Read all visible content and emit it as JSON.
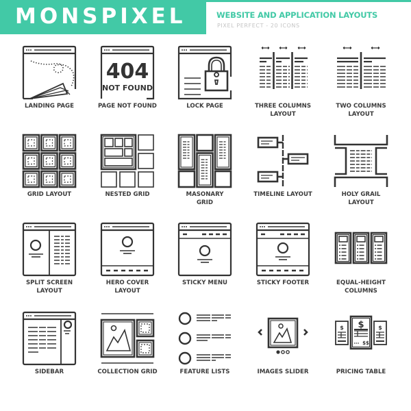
{
  "header": {
    "brand": "MONSPIXEL",
    "title": "WEBSITE AND APPLICATION LAYOUTS",
    "tagline": "PIXEL PERFECT - 20 ICONS",
    "accent_color": "#42c9a6",
    "icon_color": "#333333"
  },
  "icons": [
    {
      "icon": "landing-page-icon",
      "label_lines": [
        "LANDING PAGE"
      ]
    },
    {
      "icon": "page-not-found-icon",
      "label_lines": [
        "PAGE NOT FOUND"
      ],
      "glyph_big": "404",
      "glyph_small": "NOT FOUND"
    },
    {
      "icon": "lock-page-icon",
      "label_lines": [
        "LOCK PAGE"
      ]
    },
    {
      "icon": "three-columns-icon",
      "label_lines": [
        "THREE COLUMNS",
        "LAYOUT"
      ]
    },
    {
      "icon": "two-columns-icon",
      "label_lines": [
        "TWO COLUMNS",
        "LAYOUT"
      ]
    },
    {
      "icon": "grid-layout-icon",
      "label_lines": [
        "GRID LAYOUT"
      ]
    },
    {
      "icon": "nested-grid-icon",
      "label_lines": [
        "NESTED GRID"
      ]
    },
    {
      "icon": "masonary-grid-icon",
      "label_lines": [
        "MASONARY",
        "GRID"
      ]
    },
    {
      "icon": "timeline-layout-icon",
      "label_lines": [
        "TIMELINE LAYOUT"
      ]
    },
    {
      "icon": "holy-grail-icon",
      "label_lines": [
        "HOLY GRAIL",
        "LAYOUT"
      ]
    },
    {
      "icon": "split-screen-icon",
      "label_lines": [
        "SPLIT SCREEN",
        "LAYOUT"
      ]
    },
    {
      "icon": "hero-cover-icon",
      "label_lines": [
        "HERO COVER",
        "LAYOUT"
      ]
    },
    {
      "icon": "sticky-menu-icon",
      "label_lines": [
        "STICKY MENU"
      ]
    },
    {
      "icon": "sticky-footer-icon",
      "label_lines": [
        "STICKY FOOTER"
      ]
    },
    {
      "icon": "equal-height-columns-icon",
      "label_lines": [
        "EQUAL-HEIGHT",
        "COLUMNS"
      ]
    },
    {
      "icon": "sidebar-icon",
      "label_lines": [
        "SIDEBAR"
      ]
    },
    {
      "icon": "collection-grid-icon",
      "label_lines": [
        "COLLECTION GRID"
      ]
    },
    {
      "icon": "feature-lists-icon",
      "label_lines": [
        "FEATURE LISTS"
      ]
    },
    {
      "icon": "images-slider-icon",
      "label_lines": [
        "IMAGES SLIDER"
      ]
    },
    {
      "icon": "pricing-table-icon",
      "label_lines": [
        "PRICING TABLE"
      ],
      "glyph_big": "$",
      "glyph_small": "$$"
    }
  ]
}
